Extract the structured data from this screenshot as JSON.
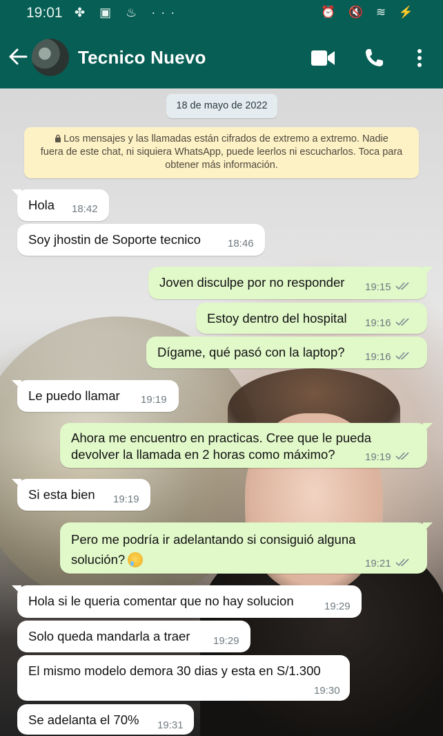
{
  "status_bar": {
    "time": "19:01",
    "left_icons": "✤ ▣ ♨ ···",
    "right_icons": "⏰ 🔇 ≋ ⚡"
  },
  "header": {
    "contact_name": "Tecnico Nuevo",
    "color": "#075e54"
  },
  "chat": {
    "date_chip": "18 de mayo de 2022",
    "encryption_notice": {
      "line1": "Los mensajes y las llamadas están cifrados de extremo a extremo. Nadie",
      "line2": "fuera de este chat, ni siquiera WhatsApp, puede leerlos ni escucharlos. Toca para",
      "line3": "obtener más información."
    },
    "messages": [
      {
        "direction": "in",
        "text": "Hola",
        "time": "18:42"
      },
      {
        "direction": "in",
        "text": "Soy jhostin de Soporte tecnico",
        "time": "18:46"
      },
      {
        "direction": "out",
        "text": "Joven disculpe por no responder",
        "time": "19:15",
        "status": "read"
      },
      {
        "direction": "out",
        "text": "Estoy dentro del hospital",
        "time": "19:16",
        "status": "read"
      },
      {
        "direction": "out",
        "text": "Dígame,  qué pasó con la laptop?",
        "time": "19:16",
        "status": "read"
      },
      {
        "direction": "in",
        "text": "Le puedo llamar",
        "time": "19:19"
      },
      {
        "direction": "out",
        "line1": "Ahora me encuentro en practicas. Cree que le pueda",
        "line2": "devolver la llamada en 2 horas como máximo?",
        "time": "19:19",
        "status": "read"
      },
      {
        "direction": "in",
        "text": "Si esta bien",
        "time": "19:19"
      },
      {
        "direction": "out",
        "line1": "Pero me podría ir adelantando si consiguió alguna",
        "line2": "solución?",
        "emoji": "crying-face",
        "time": "19:21",
        "status": "read"
      },
      {
        "direction": "in",
        "text": "Hola si le queria comentar que no hay solucion",
        "time": "19:29"
      },
      {
        "direction": "in",
        "text": "Solo queda mandarla a traer",
        "time": "19:29"
      },
      {
        "direction": "in",
        "text": "El mismo modelo demora 30 dias y esta en S/1.300",
        "time": "19:30"
      },
      {
        "direction": "in",
        "text": "Se adelanta el 70%",
        "time": "19:31"
      }
    ]
  },
  "colors": {
    "outgoing_bubble": "#e1f8c9",
    "incoming_bubble": "#ffffff",
    "notice_bg": "#fdf1c6",
    "read_tick": "#4fa3d9"
  }
}
